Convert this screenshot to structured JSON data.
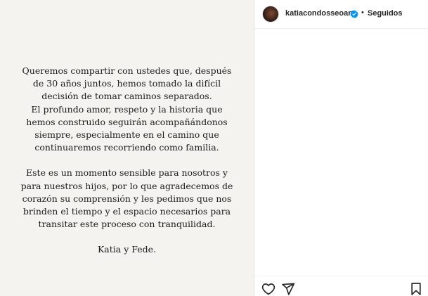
{
  "post": {
    "paragraphs": [
      {
        "lines": [
          "Queremos compartir con ustedes que, después",
          "de 30 años juntos, hemos tomado la difícil",
          "decisión de tomar caminos separados.",
          "El profundo amor, respeto y la historia que",
          "hemos construido seguirán acompañándonos",
          "siempre, especialmente en el camino que",
          "continuaremos recorriendo como familia."
        ]
      },
      {
        "lines": [
          "Este es un momento sensible para nosotros y",
          "para nuestros hijos, por lo que agradecemos de",
          "corazón su comprensión y les pedimos que nos",
          "brinden el tiempo y el espacio necesarios para",
          "transitar este proceso con tranquilidad."
        ]
      },
      {
        "lines": [
          "Katia y Fede."
        ]
      }
    ]
  },
  "header": {
    "username": "katiacondosseoane",
    "separator": "•",
    "follow_status": "Seguidos"
  },
  "icons": {
    "avatar": "profile-avatar",
    "verified": "verified-badge-icon",
    "like": "heart-icon",
    "share": "paper-plane-icon",
    "save": "bookmark-icon"
  },
  "colors": {
    "verified": "#0095f6",
    "text": "#262626",
    "post_background": "#f4f3ef"
  }
}
